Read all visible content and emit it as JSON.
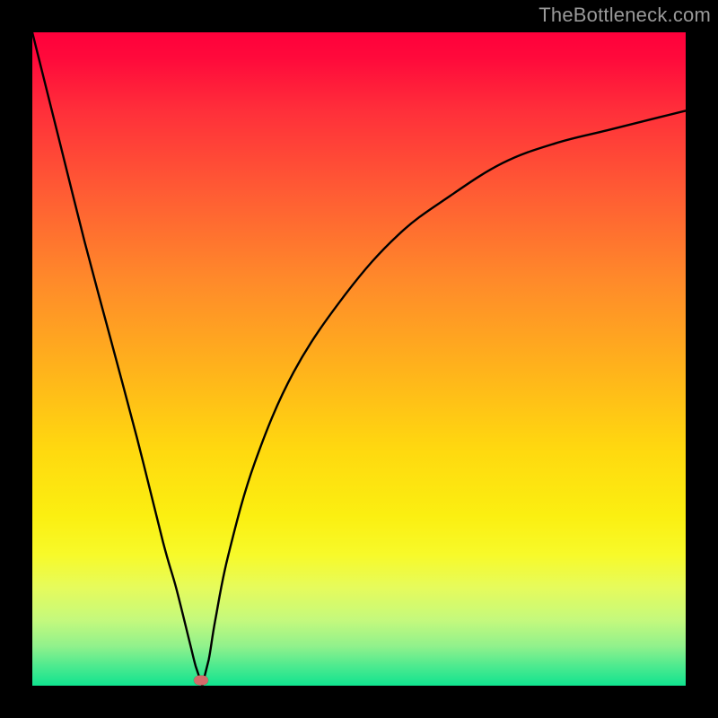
{
  "watermark": "TheBottleneck.com",
  "marker": {
    "x_frac": 0.258,
    "y_frac": 0.992
  },
  "chart_data": {
    "type": "line",
    "title": "",
    "xlabel": "",
    "ylabel": "",
    "xlim": [
      0,
      100
    ],
    "ylim": [
      0,
      100
    ],
    "grid": false,
    "legend": false,
    "description": "Bottleneck-style V curve: single black line that starts near the top-left, drops steeply and nearly linearly to a sharp minimum around x≈26 (near y=0), then rises with decreasing slope toward the top-right. Background is a red→yellow→green vertical gradient. A small rounded pink marker sits at the minimum.",
    "series": [
      {
        "name": "curve",
        "x": [
          0,
          4,
          8,
          12,
          16,
          20,
          22,
          24,
          25,
          26,
          27,
          28,
          30,
          34,
          40,
          48,
          56,
          64,
          72,
          80,
          88,
          96,
          100
        ],
        "y": [
          100,
          84,
          68,
          53,
          38,
          22,
          15,
          7,
          3,
          0,
          4,
          10,
          20,
          34,
          48,
          60,
          69,
          75,
          80,
          83,
          85,
          87,
          88
        ]
      }
    ],
    "marker_point": {
      "x": 26,
      "y": 0.8
    },
    "colors": {
      "line": "#000000",
      "marker": "#d46a6a",
      "gradient_top": "#ff003b",
      "gradient_mid": "#ffd90f",
      "gradient_bottom": "#11e38f",
      "frame": "#000000"
    }
  }
}
